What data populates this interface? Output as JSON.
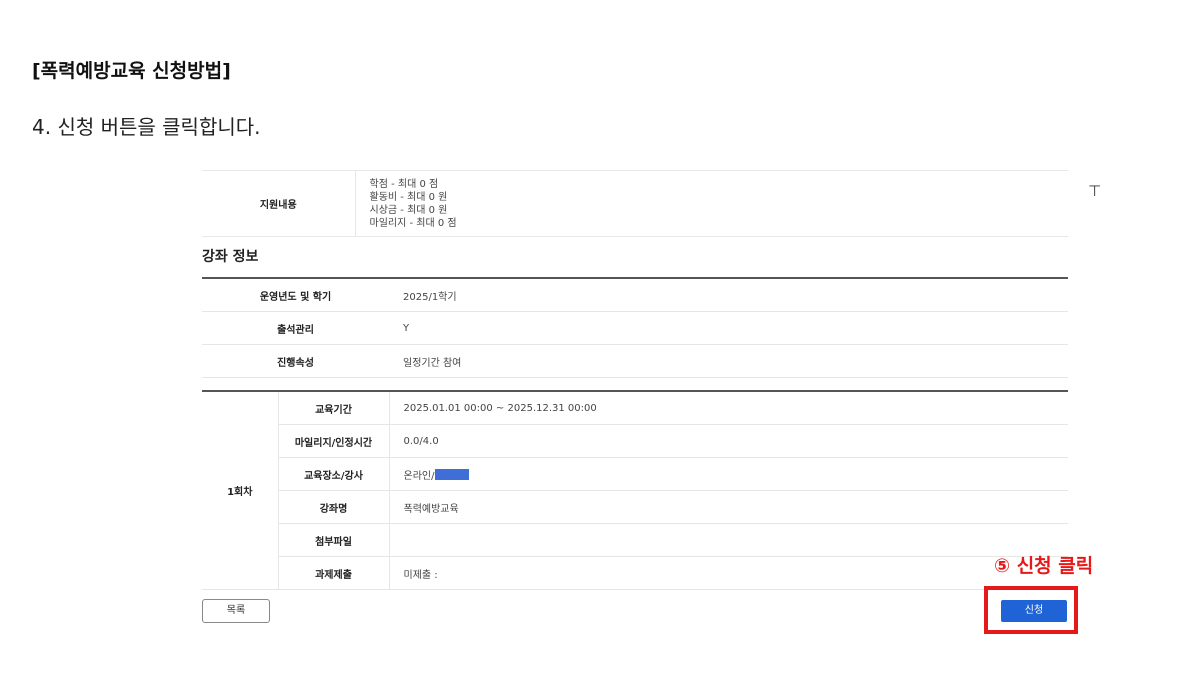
{
  "doc": {
    "title": "[폭력예방교육 신청방법]",
    "step": "4. 신청 버튼을 클릭합니다."
  },
  "support": {
    "label": "지원내용",
    "lines": [
      "학점 - 최대 0 점",
      "활동비 - 최대 0 원",
      "시상금 - 최대 0 원",
      "마일리지 - 최대 0 점"
    ]
  },
  "course_section_title": "강좌 정보",
  "course_info": [
    {
      "label": "운영년도 및 학기",
      "value": "2025/1학기"
    },
    {
      "label": "출석관리",
      "value": "Y"
    },
    {
      "label": "진행속성",
      "value": "일정기간 참여"
    }
  ],
  "session": {
    "name": "1회차",
    "rows": [
      {
        "label": "교육기간",
        "value": "2025.01.01 00:00 ~  2025.12.31 00:00"
      },
      {
        "label": "마일리지/인정시간",
        "value": "0.0/4.0"
      },
      {
        "label": "교육장소/강사",
        "value": "온라인/"
      },
      {
        "label": "강좌명",
        "value": "폭력예방교육"
      },
      {
        "label": "첨부파일",
        "value": ""
      },
      {
        "label": "과제제출",
        "value": "미제출 :"
      }
    ]
  },
  "buttons": {
    "list_label": "목록",
    "apply_label": "신청"
  },
  "annotation": {
    "callout": "⑤ 신청 클릭",
    "color": "#e51919"
  },
  "icons": {
    "scroll_top": "scroll-top-icon",
    "scroll_top_glyph": "⊤"
  },
  "colors": {
    "apply_button": "#1f63d6",
    "masked_name": "#3f6fd6"
  }
}
